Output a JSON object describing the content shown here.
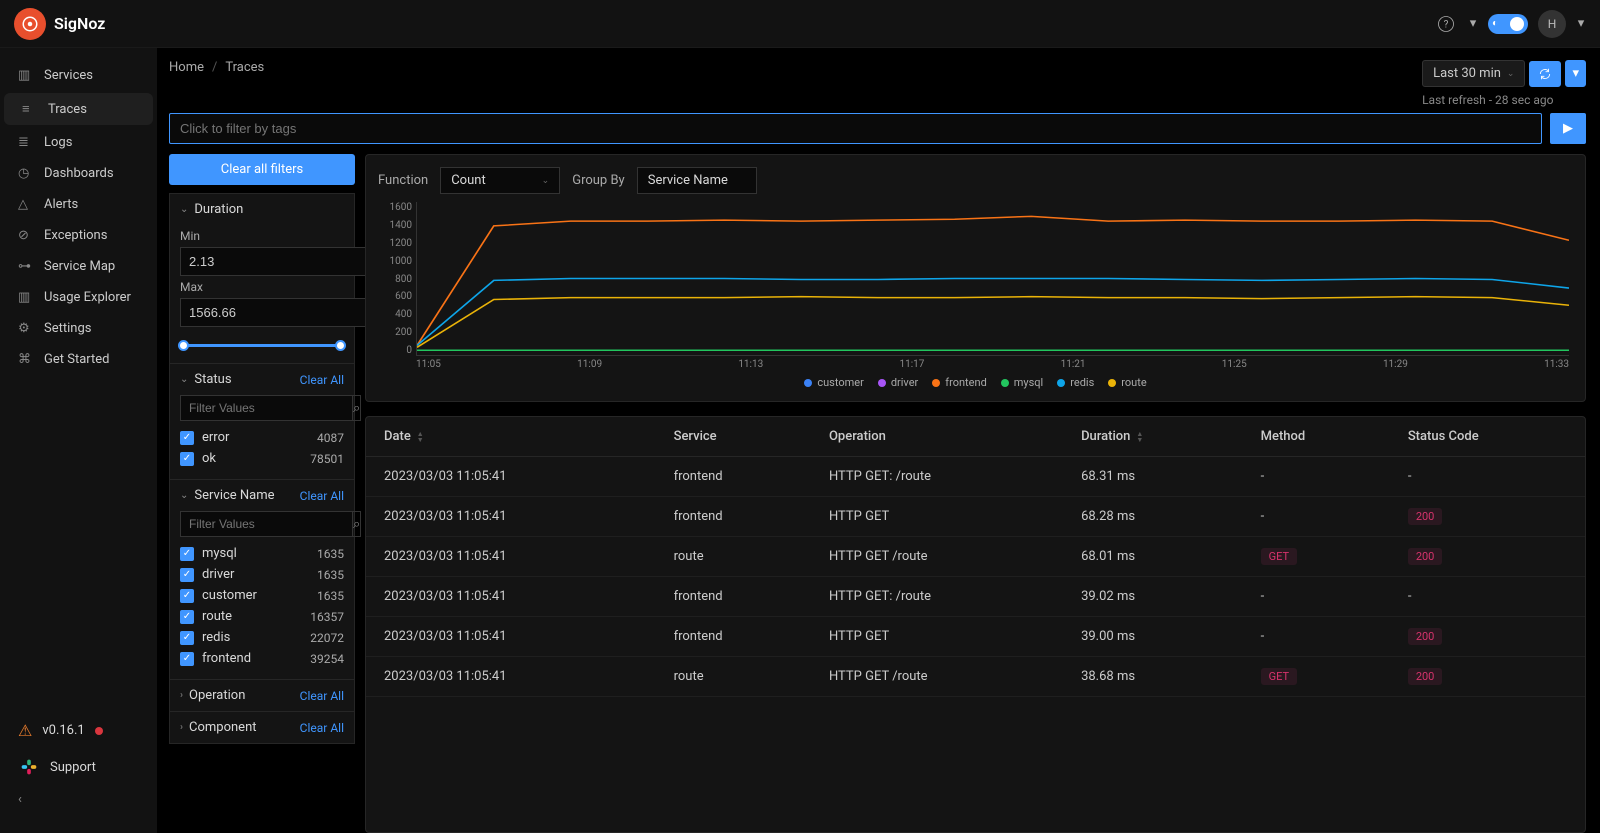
{
  "brand": "SigNoz",
  "nav": [
    {
      "label": "Services",
      "icon": "bar"
    },
    {
      "label": "Traces",
      "icon": "menu",
      "active": true
    },
    {
      "label": "Logs",
      "icon": "lines"
    },
    {
      "label": "Dashboards",
      "icon": "gauge"
    },
    {
      "label": "Alerts",
      "icon": "bell"
    },
    {
      "label": "Exceptions",
      "icon": "warn"
    },
    {
      "label": "Service Map",
      "icon": "graph"
    },
    {
      "label": "Usage Explorer",
      "icon": "bar"
    },
    {
      "label": "Settings",
      "icon": "gear"
    },
    {
      "label": "Get Started",
      "icon": "link"
    }
  ],
  "version": "v0.16.1",
  "support": "Support",
  "breadcrumb": {
    "home": "Home",
    "current": "Traces",
    "sep": "/"
  },
  "time": {
    "range": "Last 30 min",
    "refresh": "Last refresh - 28 sec ago"
  },
  "filter_placeholder": "Click to filter by tags",
  "clear_all": "Clear all filters",
  "clear": "Clear All",
  "sections": {
    "duration": "Duration",
    "min_label": "Min",
    "min_val": "2.13",
    "max_label": "Max",
    "max_val": "1566.66",
    "unit": "ms",
    "status": "Status",
    "service_name": "Service Name",
    "operation": "Operation",
    "component": "Component",
    "filter_values": "Filter Values"
  },
  "status_items": [
    {
      "label": "error",
      "count": "4087"
    },
    {
      "label": "ok",
      "count": "78501"
    }
  ],
  "service_items": [
    {
      "label": "mysql",
      "count": "1635"
    },
    {
      "label": "driver",
      "count": "1635"
    },
    {
      "label": "customer",
      "count": "1635"
    },
    {
      "label": "route",
      "count": "16357"
    },
    {
      "label": "redis",
      "count": "22072"
    },
    {
      "label": "frontend",
      "count": "39254"
    }
  ],
  "chart_controls": {
    "function_label": "Function",
    "function_value": "Count",
    "groupby_label": "Group By",
    "groupby_value": "Service Name"
  },
  "chart_data": {
    "type": "line",
    "ylim": [
      0,
      1600
    ],
    "y_ticks": [
      "1600",
      "1400",
      "1200",
      "1000",
      "800",
      "600",
      "400",
      "200",
      "0"
    ],
    "x_ticks": [
      "11:05",
      "11:09",
      "11:13",
      "11:17",
      "11:21",
      "11:25",
      "11:29",
      "11:33"
    ],
    "series": [
      {
        "name": "customer",
        "color": "#3b82f6",
        "values": [
          50,
          50,
          50,
          50,
          50,
          50,
          50,
          50,
          50,
          50,
          50,
          50,
          50,
          50,
          50,
          50
        ]
      },
      {
        "name": "driver",
        "color": "#a855f7",
        "values": [
          50,
          50,
          50,
          50,
          50,
          50,
          50,
          50,
          50,
          50,
          50,
          50,
          50,
          50,
          50,
          50
        ]
      },
      {
        "name": "frontend",
        "color": "#f97316",
        "values": [
          100,
          1350,
          1400,
          1400,
          1410,
          1400,
          1410,
          1420,
          1450,
          1400,
          1410,
          1400,
          1400,
          1410,
          1400,
          1200
        ]
      },
      {
        "name": "mysql",
        "color": "#22c55e",
        "values": [
          50,
          50,
          50,
          50,
          50,
          50,
          50,
          50,
          50,
          50,
          50,
          50,
          50,
          50,
          50,
          50
        ]
      },
      {
        "name": "redis",
        "color": "#0ea5e9",
        "values": [
          100,
          780,
          800,
          800,
          800,
          790,
          790,
          800,
          800,
          800,
          790,
          780,
          790,
          800,
          790,
          700
        ]
      },
      {
        "name": "route",
        "color": "#eab308",
        "values": [
          80,
          580,
          600,
          600,
          600,
          610,
          600,
          600,
          610,
          600,
          600,
          590,
          600,
          610,
          600,
          520
        ]
      }
    ]
  },
  "table": {
    "columns": [
      "Date",
      "Service",
      "Operation",
      "Duration",
      "Method",
      "Status Code"
    ],
    "rows": [
      {
        "date": "2023/03/03 11:05:41",
        "service": "frontend",
        "operation": "HTTP GET: /route",
        "duration": "68.31 ms",
        "method": "-",
        "status": "-"
      },
      {
        "date": "2023/03/03 11:05:41",
        "service": "frontend",
        "operation": "HTTP GET",
        "duration": "68.28 ms",
        "method": "-",
        "status": "200",
        "status_tag": true
      },
      {
        "date": "2023/03/03 11:05:41",
        "service": "route",
        "operation": "HTTP GET /route",
        "duration": "68.01 ms",
        "method": "GET",
        "method_tag": true,
        "status": "200",
        "status_tag": true
      },
      {
        "date": "2023/03/03 11:05:41",
        "service": "frontend",
        "operation": "HTTP GET: /route",
        "duration": "39.02 ms",
        "method": "-",
        "status": "-"
      },
      {
        "date": "2023/03/03 11:05:41",
        "service": "frontend",
        "operation": "HTTP GET",
        "duration": "39.00 ms",
        "method": "-",
        "status": "200",
        "status_tag": true
      },
      {
        "date": "2023/03/03 11:05:41",
        "service": "route",
        "operation": "HTTP GET /route",
        "duration": "38.68 ms",
        "method": "GET",
        "method_tag": true,
        "status": "200",
        "status_tag": true
      }
    ]
  },
  "user_initial": "H"
}
